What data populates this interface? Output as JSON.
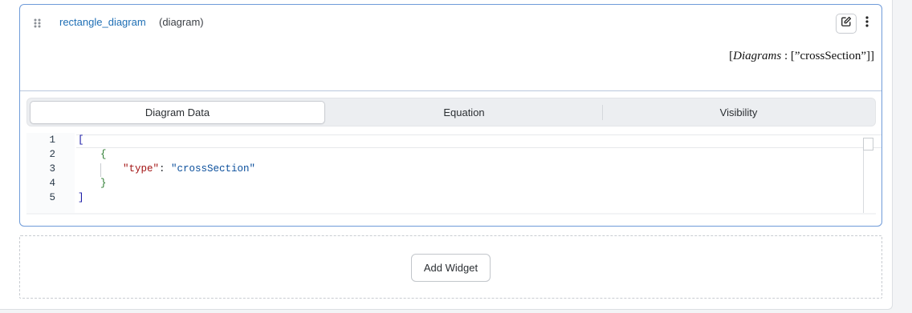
{
  "widget": {
    "name": "rectangle_diagram",
    "type_label": "(diagram)",
    "formula": {
      "open": "[",
      "name": "Diagrams",
      "sep": " : ",
      "value": "[”crossSection”]",
      "close": "]"
    },
    "icons": {
      "drag": "drag-handle-icon",
      "edit": "edit-icon",
      "menu": "more-vertical-icon"
    }
  },
  "tabs": [
    {
      "label": "Diagram Data",
      "active": true
    },
    {
      "label": "Equation",
      "active": false
    },
    {
      "label": "Visibility",
      "active": false
    }
  ],
  "editor": {
    "line_numbers": [
      "1",
      "2",
      "3",
      "4",
      "5"
    ],
    "lines": {
      "l1": "[",
      "l2": "{",
      "l3_key": "\"type\"",
      "l3_colon": ": ",
      "l3_value": "\"crossSection\"",
      "l4": "}",
      "l5": "]"
    }
  },
  "add_widget": {
    "label": "Add Widget"
  },
  "colors": {
    "link": "#1f6fb5",
    "card_border": "#6f9bd9",
    "json_key": "#a31515",
    "json_string": "#0b4f9c",
    "json_bracket": "#1a1aa6",
    "json_brace": "#2e7d32"
  }
}
